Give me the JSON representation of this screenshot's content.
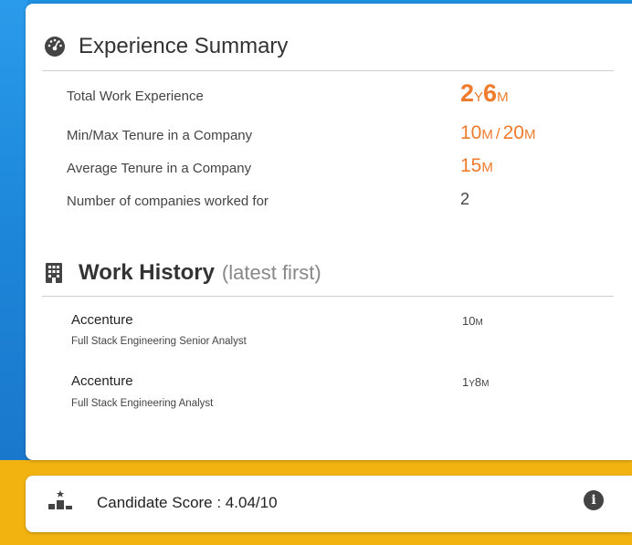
{
  "experience": {
    "title": "Experience Summary",
    "icon": "dashboard-gauge-icon",
    "rows": [
      {
        "label": "Total Work Experience",
        "value": {
          "years": "2",
          "y_unit": "Y",
          "months": "6",
          "m_unit": "M"
        }
      },
      {
        "label": "Min/Max Tenure in a Company",
        "value": {
          "min": "10",
          "min_unit": "M",
          "sep": "/",
          "max": "20",
          "max_unit": "M"
        }
      },
      {
        "label": "Average Tenure in a Company",
        "value": {
          "avg": "15",
          "avg_unit": "M"
        }
      },
      {
        "label": "Number of companies worked for",
        "value": {
          "count": "2"
        }
      }
    ]
  },
  "work_history": {
    "title": "Work History",
    "subtitle": "(latest first)",
    "icon": "building-icon",
    "entries": [
      {
        "company": "Accenture",
        "role": "Full Stack Engineering Senior Analyst",
        "duration": {
          "num1": "10",
          "unit1": "M",
          "num2": "",
          "unit2": ""
        }
      },
      {
        "company": "Accenture",
        "role": "Full Stack Engineering Analyst",
        "duration": {
          "num1": "1",
          "unit1": "Y",
          "num2": "8",
          "unit2": "M"
        }
      }
    ]
  },
  "score": {
    "label": "Candidate Score : 4.04/10",
    "icon": "podium-icon",
    "info_icon": "info-icon",
    "info_glyph": "i"
  },
  "colors": {
    "accent": "#ef7b2c",
    "gold": "#f2b311",
    "blue": "#1b7fd4"
  }
}
